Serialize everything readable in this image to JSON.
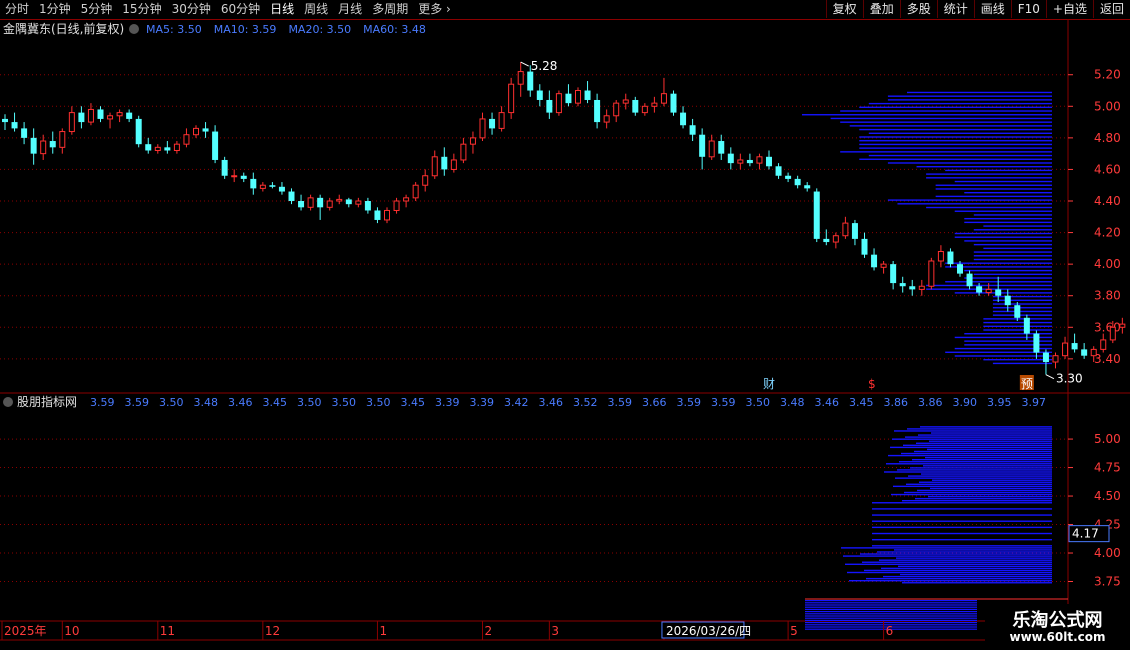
{
  "toolbar": {
    "periods": [
      "分时",
      "1分钟",
      "5分钟",
      "15分钟",
      "30分钟",
      "60分钟",
      "日线",
      "周线",
      "月线",
      "多周期",
      "更多"
    ],
    "more_arrow": "›",
    "active_period": "日线",
    "buttons": [
      "复权",
      "叠加",
      "多股",
      "统计",
      "画线",
      "F10",
      "+自选",
      "返回"
    ]
  },
  "main_panel": {
    "title": "金隅冀东(日线,前复权)",
    "ma_legend": [
      {
        "label": "MA5: 3.50",
        "color": "#4a7bff"
      },
      {
        "label": "MA10: 3.59",
        "color": "#4a7bff"
      },
      {
        "label": "MA20: 3.50",
        "color": "#4a7bff"
      },
      {
        "label": "MA60: 3.48",
        "color": "#4a7bff"
      }
    ],
    "high_label": "5.28",
    "low_label": "3.30",
    "markers": [
      {
        "text": "财",
        "index": 80
      },
      {
        "text": "$",
        "index": 91
      },
      {
        "text": "预",
        "index": 107
      }
    ]
  },
  "sub_panel": {
    "title": "股朋指标网",
    "current_value": "4.17"
  },
  "time_axis": {
    "labels": [
      {
        "text": "2025年",
        "index": 0
      },
      {
        "text": "10",
        "index": 6
      },
      {
        "text": "11",
        "index": 16
      },
      {
        "text": "12",
        "index": 27
      },
      {
        "text": "1",
        "index": 39
      },
      {
        "text": "2",
        "index": 50
      },
      {
        "text": "3",
        "index": 57
      },
      {
        "text": "2026/03/26/四",
        "index": 69,
        "highlight": true
      },
      {
        "text": "5",
        "index": 82
      },
      {
        "text": "6",
        "index": 92
      }
    ]
  },
  "watermark": {
    "title": "乐淘公式网",
    "url": "www.60lt.com"
  },
  "colors": {
    "up": "#ff3030",
    "down": "#54ffff",
    "grid": "#8b0000",
    "axis_text": "#ff3b3b",
    "volume_profile": "#1414ff",
    "legend_text": "#4a7bff"
  },
  "chart_data": [
    {
      "type": "candlestick",
      "title": "金隅冀东(日线,前复权)",
      "y_ticks": [
        3.4,
        3.6,
        3.8,
        4.0,
        4.2,
        4.4,
        4.6,
        4.8,
        5.0,
        5.2
      ],
      "ylim": [
        3.19,
        5.42
      ],
      "candles": [
        {
          "o": 4.92,
          "h": 4.95,
          "l": 4.85,
          "c": 4.9
        },
        {
          "o": 4.9,
          "h": 4.96,
          "l": 4.84,
          "c": 4.86
        },
        {
          "o": 4.86,
          "h": 4.9,
          "l": 4.76,
          "c": 4.8
        },
        {
          "o": 4.8,
          "h": 4.86,
          "l": 4.63,
          "c": 4.7
        },
        {
          "o": 4.7,
          "h": 4.82,
          "l": 4.66,
          "c": 4.78
        },
        {
          "o": 4.78,
          "h": 4.84,
          "l": 4.7,
          "c": 4.74
        },
        {
          "o": 4.74,
          "h": 4.86,
          "l": 4.7,
          "c": 4.84
        },
        {
          "o": 4.84,
          "h": 5.0,
          "l": 4.82,
          "c": 4.96
        },
        {
          "o": 4.96,
          "h": 5.0,
          "l": 4.86,
          "c": 4.9
        },
        {
          "o": 4.9,
          "h": 5.02,
          "l": 4.88,
          "c": 4.98
        },
        {
          "o": 4.98,
          "h": 5.0,
          "l": 4.9,
          "c": 4.92
        },
        {
          "o": 4.92,
          "h": 4.96,
          "l": 4.86,
          "c": 4.94
        },
        {
          "o": 4.94,
          "h": 4.98,
          "l": 4.9,
          "c": 4.96
        },
        {
          "o": 4.96,
          "h": 4.98,
          "l": 4.9,
          "c": 4.92
        },
        {
          "o": 4.92,
          "h": 4.94,
          "l": 4.74,
          "c": 4.76
        },
        {
          "o": 4.76,
          "h": 4.8,
          "l": 4.7,
          "c": 4.72
        },
        {
          "o": 4.72,
          "h": 4.76,
          "l": 4.7,
          "c": 4.74
        },
        {
          "o": 4.74,
          "h": 4.78,
          "l": 4.7,
          "c": 4.72
        },
        {
          "o": 4.72,
          "h": 4.78,
          "l": 4.7,
          "c": 4.76
        },
        {
          "o": 4.76,
          "h": 4.86,
          "l": 4.74,
          "c": 4.82
        },
        {
          "o": 4.82,
          "h": 4.88,
          "l": 4.8,
          "c": 4.86
        },
        {
          "o": 4.86,
          "h": 4.9,
          "l": 4.8,
          "c": 4.84
        },
        {
          "o": 4.84,
          "h": 4.88,
          "l": 4.64,
          "c": 4.66
        },
        {
          "o": 4.66,
          "h": 4.68,
          "l": 4.54,
          "c": 4.56
        },
        {
          "o": 4.56,
          "h": 4.6,
          "l": 4.52,
          "c": 4.56
        },
        {
          "o": 4.56,
          "h": 4.58,
          "l": 4.52,
          "c": 4.54
        },
        {
          "o": 4.54,
          "h": 4.58,
          "l": 4.44,
          "c": 4.48
        },
        {
          "o": 4.48,
          "h": 4.52,
          "l": 4.46,
          "c": 4.5
        },
        {
          "o": 4.5,
          "h": 4.52,
          "l": 4.48,
          "c": 4.49
        },
        {
          "o": 4.49,
          "h": 4.52,
          "l": 4.44,
          "c": 4.46
        },
        {
          "o": 4.46,
          "h": 4.48,
          "l": 4.38,
          "c": 4.4
        },
        {
          "o": 4.4,
          "h": 4.44,
          "l": 4.34,
          "c": 4.36
        },
        {
          "o": 4.36,
          "h": 4.44,
          "l": 4.34,
          "c": 4.42
        },
        {
          "o": 4.42,
          "h": 4.44,
          "l": 4.28,
          "c": 4.36
        },
        {
          "o": 4.36,
          "h": 4.42,
          "l": 4.34,
          "c": 4.4
        },
        {
          "o": 4.4,
          "h": 4.44,
          "l": 4.38,
          "c": 4.41
        },
        {
          "o": 4.41,
          "h": 4.42,
          "l": 4.36,
          "c": 4.38
        },
        {
          "o": 4.38,
          "h": 4.42,
          "l": 4.36,
          "c": 4.4
        },
        {
          "o": 4.4,
          "h": 4.42,
          "l": 4.32,
          "c": 4.34
        },
        {
          "o": 4.34,
          "h": 4.36,
          "l": 4.26,
          "c": 4.28
        },
        {
          "o": 4.28,
          "h": 4.36,
          "l": 4.26,
          "c": 4.34
        },
        {
          "o": 4.34,
          "h": 4.42,
          "l": 4.32,
          "c": 4.4
        },
        {
          "o": 4.4,
          "h": 4.44,
          "l": 4.36,
          "c": 4.42
        },
        {
          "o": 4.42,
          "h": 4.52,
          "l": 4.4,
          "c": 4.5
        },
        {
          "o": 4.5,
          "h": 4.6,
          "l": 4.46,
          "c": 4.56
        },
        {
          "o": 4.56,
          "h": 4.72,
          "l": 4.54,
          "c": 4.68
        },
        {
          "o": 4.68,
          "h": 4.74,
          "l": 4.56,
          "c": 4.6
        },
        {
          "o": 4.6,
          "h": 4.7,
          "l": 4.58,
          "c": 4.66
        },
        {
          "o": 4.66,
          "h": 4.8,
          "l": 4.64,
          "c": 4.76
        },
        {
          "o": 4.76,
          "h": 4.84,
          "l": 4.7,
          "c": 4.8
        },
        {
          "o": 4.8,
          "h": 4.96,
          "l": 4.78,
          "c": 4.92
        },
        {
          "o": 4.92,
          "h": 4.96,
          "l": 4.82,
          "c": 4.86
        },
        {
          "o": 4.86,
          "h": 5.0,
          "l": 4.84,
          "c": 4.96
        },
        {
          "o": 4.96,
          "h": 5.18,
          "l": 4.92,
          "c": 5.14
        },
        {
          "o": 5.14,
          "h": 5.28,
          "l": 5.06,
          "c": 5.22
        },
        {
          "o": 5.22,
          "h": 5.26,
          "l": 5.06,
          "c": 5.1
        },
        {
          "o": 5.1,
          "h": 5.14,
          "l": 5.0,
          "c": 5.04
        },
        {
          "o": 5.04,
          "h": 5.1,
          "l": 4.92,
          "c": 4.96
        },
        {
          "o": 4.96,
          "h": 5.1,
          "l": 4.94,
          "c": 5.08
        },
        {
          "o": 5.08,
          "h": 5.14,
          "l": 5.0,
          "c": 5.02
        },
        {
          "o": 5.02,
          "h": 5.12,
          "l": 5.0,
          "c": 5.1
        },
        {
          "o": 5.1,
          "h": 5.16,
          "l": 5.02,
          "c": 5.04
        },
        {
          "o": 5.04,
          "h": 5.08,
          "l": 4.86,
          "c": 4.9
        },
        {
          "o": 4.9,
          "h": 4.98,
          "l": 4.86,
          "c": 4.94
        },
        {
          "o": 4.94,
          "h": 5.04,
          "l": 4.9,
          "c": 5.02
        },
        {
          "o": 5.02,
          "h": 5.08,
          "l": 4.98,
          "c": 5.04
        },
        {
          "o": 5.04,
          "h": 5.06,
          "l": 4.94,
          "c": 4.96
        },
        {
          "o": 4.96,
          "h": 5.02,
          "l": 4.94,
          "c": 5.0
        },
        {
          "o": 5.0,
          "h": 5.06,
          "l": 4.96,
          "c": 5.02
        },
        {
          "o": 5.02,
          "h": 5.18,
          "l": 5.0,
          "c": 5.08
        },
        {
          "o": 5.08,
          "h": 5.1,
          "l": 4.94,
          "c": 4.96
        },
        {
          "o": 4.96,
          "h": 5.0,
          "l": 4.86,
          "c": 4.88
        },
        {
          "o": 4.88,
          "h": 4.92,
          "l": 4.78,
          "c": 4.82
        },
        {
          "o": 4.82,
          "h": 4.86,
          "l": 4.6,
          "c": 4.68
        },
        {
          "o": 4.68,
          "h": 4.82,
          "l": 4.66,
          "c": 4.78
        },
        {
          "o": 4.78,
          "h": 4.82,
          "l": 4.66,
          "c": 4.7
        },
        {
          "o": 4.7,
          "h": 4.74,
          "l": 4.6,
          "c": 4.64
        },
        {
          "o": 4.64,
          "h": 4.7,
          "l": 4.6,
          "c": 4.66
        },
        {
          "o": 4.66,
          "h": 4.7,
          "l": 4.62,
          "c": 4.64
        },
        {
          "o": 4.64,
          "h": 4.7,
          "l": 4.6,
          "c": 4.68
        },
        {
          "o": 4.68,
          "h": 4.72,
          "l": 4.6,
          "c": 4.62
        },
        {
          "o": 4.62,
          "h": 4.64,
          "l": 4.54,
          "c": 4.56
        },
        {
          "o": 4.56,
          "h": 4.58,
          "l": 4.52,
          "c": 4.54
        },
        {
          "o": 4.54,
          "h": 4.56,
          "l": 4.48,
          "c": 4.5
        },
        {
          "o": 4.5,
          "h": 4.52,
          "l": 4.46,
          "c": 4.48
        },
        {
          "o": 4.46,
          "h": 4.48,
          "l": 4.14,
          "c": 4.16
        },
        {
          "o": 4.16,
          "h": 4.22,
          "l": 4.12,
          "c": 4.14
        },
        {
          "o": 4.14,
          "h": 4.2,
          "l": 4.1,
          "c": 4.18
        },
        {
          "o": 4.18,
          "h": 4.3,
          "l": 4.16,
          "c": 4.26
        },
        {
          "o": 4.26,
          "h": 4.28,
          "l": 4.12,
          "c": 4.16
        },
        {
          "o": 4.16,
          "h": 4.2,
          "l": 4.04,
          "c": 4.06
        },
        {
          "o": 4.06,
          "h": 4.1,
          "l": 3.96,
          "c": 3.98
        },
        {
          "o": 3.98,
          "h": 4.02,
          "l": 3.94,
          "c": 4.0
        },
        {
          "o": 4.0,
          "h": 4.02,
          "l": 3.84,
          "c": 3.88
        },
        {
          "o": 3.88,
          "h": 3.92,
          "l": 3.82,
          "c": 3.86
        },
        {
          "o": 3.86,
          "h": 3.9,
          "l": 3.8,
          "c": 3.84
        },
        {
          "o": 3.84,
          "h": 3.9,
          "l": 3.8,
          "c": 3.86
        },
        {
          "o": 3.86,
          "h": 4.04,
          "l": 3.84,
          "c": 4.02
        },
        {
          "o": 4.02,
          "h": 4.12,
          "l": 3.98,
          "c": 4.08
        },
        {
          "o": 4.08,
          "h": 4.1,
          "l": 3.98,
          "c": 4.0
        },
        {
          "o": 4.0,
          "h": 4.02,
          "l": 3.92,
          "c": 3.94
        },
        {
          "o": 3.94,
          "h": 3.96,
          "l": 3.84,
          "c": 3.86
        },
        {
          "o": 3.86,
          "h": 3.88,
          "l": 3.8,
          "c": 3.82
        },
        {
          "o": 3.82,
          "h": 3.88,
          "l": 3.8,
          "c": 3.84
        },
        {
          "o": 3.84,
          "h": 3.92,
          "l": 3.76,
          "c": 3.8
        },
        {
          "o": 3.8,
          "h": 3.84,
          "l": 3.7,
          "c": 3.74
        },
        {
          "o": 3.74,
          "h": 3.76,
          "l": 3.64,
          "c": 3.66
        },
        {
          "o": 3.66,
          "h": 3.68,
          "l": 3.52,
          "c": 3.56
        },
        {
          "o": 3.56,
          "h": 3.58,
          "l": 3.4,
          "c": 3.44
        },
        {
          "o": 3.44,
          "h": 3.46,
          "l": 3.3,
          "c": 3.38
        },
        {
          "o": 3.38,
          "h": 3.44,
          "l": 3.34,
          "c": 3.42
        },
        {
          "o": 3.42,
          "h": 3.54,
          "l": 3.4,
          "c": 3.5
        },
        {
          "o": 3.5,
          "h": 3.56,
          "l": 3.44,
          "c": 3.46
        },
        {
          "o": 3.46,
          "h": 3.5,
          "l": 3.4,
          "c": 3.42
        },
        {
          "o": 3.42,
          "h": 3.48,
          "l": 3.38,
          "c": 3.46
        },
        {
          "o": 3.46,
          "h": 3.56,
          "l": 3.44,
          "c": 3.52
        },
        {
          "o": 3.52,
          "h": 3.64,
          "l": 3.5,
          "c": 3.6
        },
        {
          "o": 3.6,
          "h": 3.66,
          "l": 3.56,
          "c": 3.62
        }
      ]
    },
    {
      "type": "bar",
      "title": "股朋指标网",
      "y_ticks": [
        3.75,
        4.0,
        4.25,
        4.5,
        4.75,
        5.0
      ],
      "ylim": [
        3.5,
        5.22
      ],
      "values": [
        "3.59",
        "3.59",
        "3.50",
        "3.48",
        "3.46",
        "3.45",
        "3.50",
        "3.50",
        "3.50",
        "3.45",
        "3.39",
        "3.39",
        "3.42",
        "3.46",
        "3.52",
        "3.59",
        "3.66",
        "3.59",
        "3.59",
        "3.50",
        "3.48",
        "3.46",
        "3.45",
        "3.86",
        "3.86",
        "3.90",
        "3.95",
        "3.97"
      ],
      "current": 4.17
    }
  ]
}
